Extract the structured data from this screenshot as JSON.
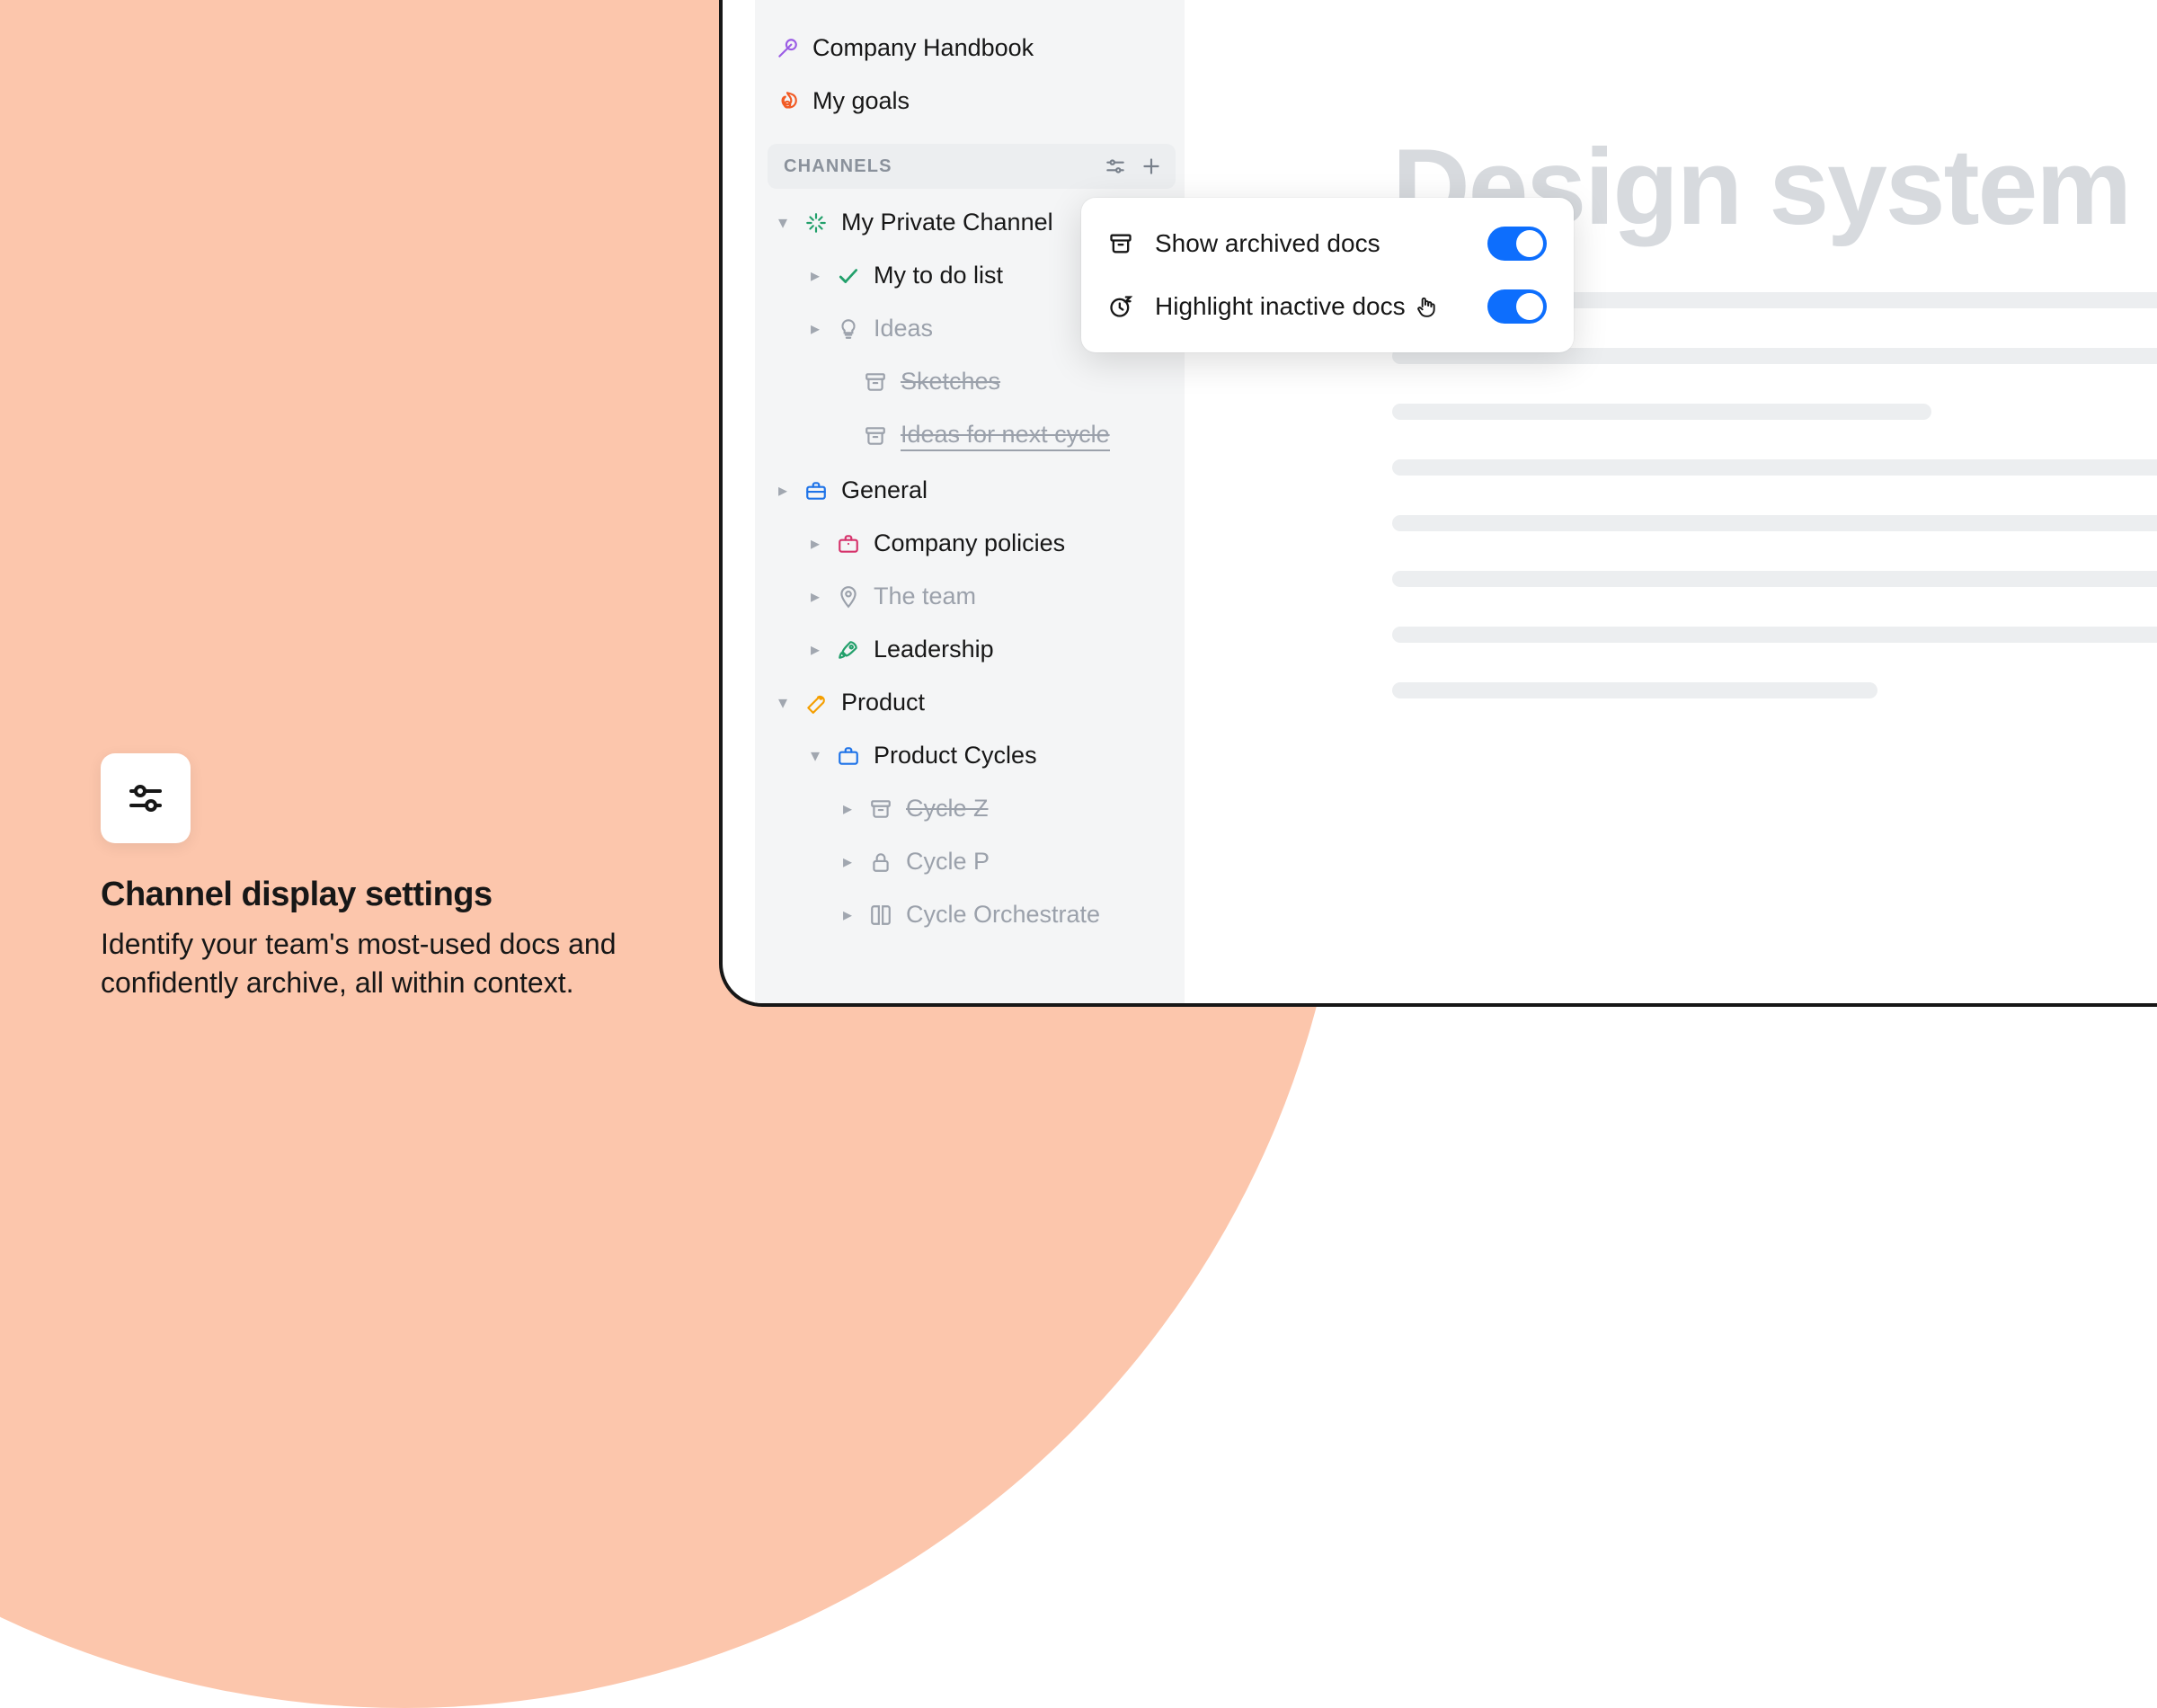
{
  "marketing": {
    "title": "Channel display settings",
    "body": "Identify your team's most-used docs and confidently archive, all within context."
  },
  "sidebar": {
    "pinned": [
      {
        "label": "Company Handbook",
        "icon": "microphone",
        "color": "#9b5de5"
      },
      {
        "label": "My goals",
        "icon": "fire",
        "color": "#f15a24"
      }
    ],
    "section_label": "CHANNELS",
    "tree": [
      {
        "label": "My Private Channel",
        "icon": "sparkle",
        "color": "#22a06b",
        "expanded": true,
        "children": [
          {
            "label": "My to do list",
            "icon": "check",
            "color": "#22a06b"
          },
          {
            "label": "Ideas",
            "icon": "bulb",
            "color": "#9ba1ab",
            "dim": true,
            "strike": false
          },
          {
            "label": "Sketches",
            "icon": "archive",
            "color": "#9ba1ab",
            "dim": true,
            "strike": true
          },
          {
            "label": "Ideas for next cycle",
            "icon": "archive",
            "color": "#9ba1ab",
            "dim": true,
            "strike": true,
            "underline": true
          }
        ]
      },
      {
        "label": "General",
        "icon": "toolbox",
        "color": "#1e73e8",
        "expanded": false,
        "children": [
          {
            "label": "Company policies",
            "icon": "briefcase",
            "color": "#d6336c"
          },
          {
            "label": "The team",
            "icon": "pin",
            "color": "#9ba1ab",
            "dim": true,
            "strike": false
          },
          {
            "label": "Leadership",
            "icon": "rocket",
            "color": "#22a06b"
          }
        ]
      },
      {
        "label": "Product",
        "icon": "wrench",
        "color": "#f59f00",
        "expanded": true,
        "children": [
          {
            "label": "Product Cycles",
            "icon": "briefcase",
            "color": "#1e73e8",
            "expanded": true,
            "children": [
              {
                "label": "Cycle Z",
                "icon": "archive",
                "color": "#9ba1ab",
                "dim": true,
                "strike": true
              },
              {
                "label": "Cycle P",
                "icon": "lock",
                "color": "#9ba1ab",
                "dim": true,
                "strike": false
              },
              {
                "label": "Cycle Orchestrate",
                "icon": "book",
                "color": "#9ba1ab",
                "dim": true,
                "strike": false
              }
            ]
          }
        ]
      }
    ]
  },
  "doc_title": "Design system",
  "popover": {
    "options": [
      {
        "label": "Show archived docs",
        "icon": "archive",
        "on": true
      },
      {
        "label": "Highlight inactive docs",
        "icon": "clock-zz",
        "on": true,
        "cursor": true
      }
    ]
  }
}
